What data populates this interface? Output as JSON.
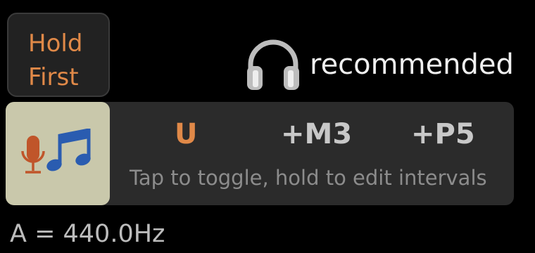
{
  "hold_button": {
    "line1": "Hold",
    "line2": "First"
  },
  "recommendation": {
    "icon": "headphones-icon",
    "text": "recommended"
  },
  "mode_button": {
    "icons": [
      "microphone-icon",
      "music-note-icon"
    ]
  },
  "intervals": [
    {
      "label": "U",
      "active": true
    },
    {
      "label": "+M3",
      "active": false
    },
    {
      "label": "+P5",
      "active": false
    }
  ],
  "hint": "Tap to toggle, hold to edit intervals",
  "reference": "A = 440.0Hz",
  "colors": {
    "accent": "#e08948",
    "background": "#000000",
    "panel": "#2b2b2b",
    "mode_button": "#c9c8ab",
    "note_blue": "#2a5cb0"
  }
}
